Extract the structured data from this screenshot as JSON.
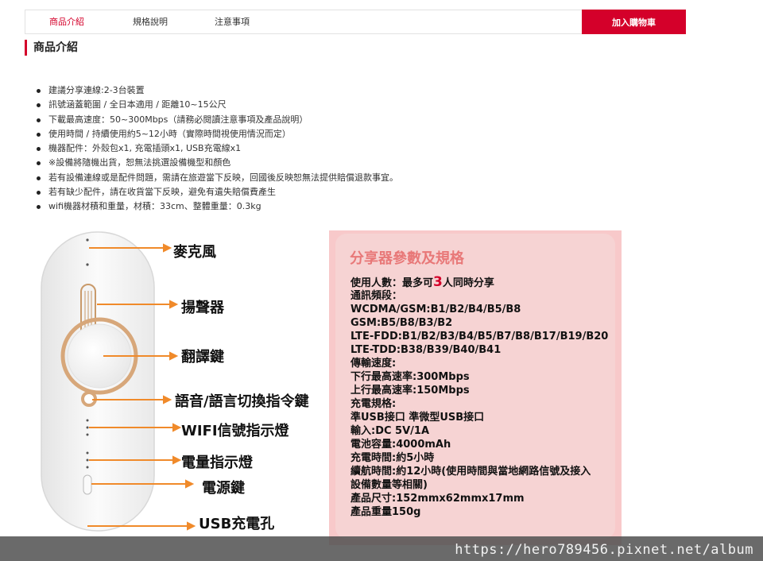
{
  "tabs": {
    "product_intro": "商品介紹",
    "specs": "規格說明",
    "notes": "注意事項",
    "add_to_cart": "加入購物車"
  },
  "section_title": "商品介紹",
  "bullets": [
    "建議分享連線:2-3台裝置",
    "訊號涵蓋範圍 / 全日本適用 / 距離10~15公尺",
    "下載最高速度：50~300Mbps（請務必閱讀注意事項及產品說明）",
    "使用時間 / 持續使用約5~12小時（實際時間視使用情況而定）",
    "機器配件：外殼包x1, 充電插頭x1, USB充電線x1",
    "※設備將隨機出貨，恕無法挑選設備機型和顏色",
    "若有設備連線或是配件問題，需請在旅遊當下反映，回國後反映恕無法提供賠償退款事宜。",
    "若有缺少配件，請在收貨當下反映，避免有遺失賠償費產生",
    "wifi機器材積和重量，材積：33cm、整體重量：0.3kg"
  ],
  "callouts": {
    "mic": "麥克風",
    "speaker": "揚聲器",
    "translate": "翻譯鍵",
    "voice": "語音/語言切換指令鍵",
    "wifi": "WIFI信號指示燈",
    "battery": "電量指示燈",
    "power": "電源鍵",
    "usb": "USB充電孔"
  },
  "spec": {
    "title": "分享器參數及規格",
    "users_prefix": "使用人數：最多可",
    "users_count": "3",
    "users_suffix": "人同時分享",
    "lines": [
      "通訊頻段：",
      "WCDMA/GSM:B1/B2/B4/B5/B8",
      "GSM:B5/B8/B3/B2",
      "LTE-FDD:B1/B2/B3/B4/B5/B7/B8/B17/B19/B20",
      "LTE-TDD:B38/B39/B40/B41",
      "傳輸速度:",
      "下行最高速率:300Mbps",
      "上行最高速率:150Mbps",
      "充電規格:",
      "準USB接口 準微型USB接口",
      "輸入:DC 5V/1A",
      "電池容量:4000mAh",
      "充電時間:約5小時",
      "續航時間:約12小時(使用時間與當地網路信號及接入",
      "設備數量等相關)",
      "產品尺寸:152mmx62mmx17mm",
      "產品重量150g"
    ]
  },
  "watermark": "https://hero789456.pixnet.net/album",
  "colors": {
    "accent": "#d4002a",
    "spec_bg": "#f6d3d3",
    "spec_title": "#e87878",
    "arrow": "#f08a2a"
  }
}
